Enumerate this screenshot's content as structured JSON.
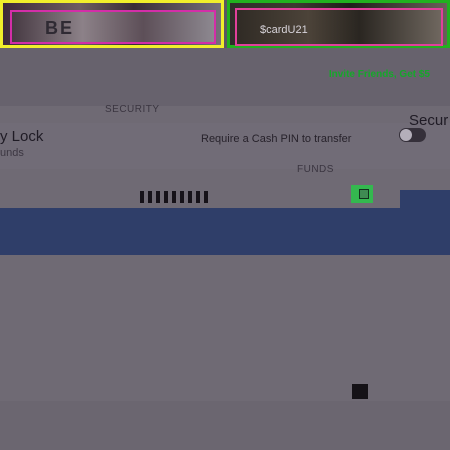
{
  "header": {
    "left_photo_text": "BE",
    "right_photo_text": "$cardU21"
  },
  "promo": {
    "invite": "Invite Friends, Get $5"
  },
  "sections": {
    "security": "SECURITY",
    "funds": "FUNDS"
  },
  "security_row": {
    "lock_title": "y Lock",
    "lock_subtitle": "unds",
    "require_text": "Require a Cash PIN to transfer",
    "right_title": "Secur"
  },
  "colors": {
    "accent_green": "#15a82a",
    "banner_blue": "#2f3e69"
  }
}
